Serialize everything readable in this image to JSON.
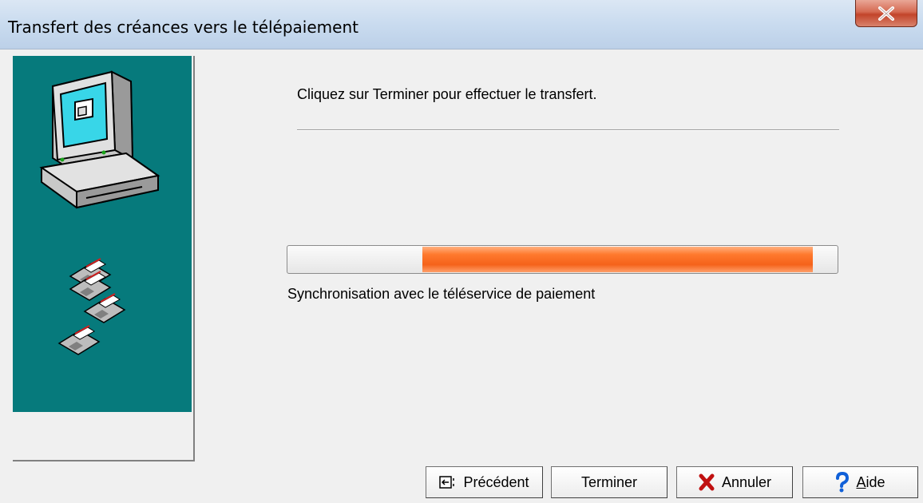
{
  "window": {
    "title": "Transfert des créances vers le télépaiement",
    "close_symbol": "x"
  },
  "wizard": {
    "instruction": "Cliquez sur Terminer pour effectuer le transfert.",
    "progress": {
      "start_fraction": 0.245,
      "end_fraction": 0.955,
      "status_text": "Synchronisation avec le téléservice de paiement"
    },
    "illustration_icons": [
      "computer-icon",
      "floppy-disks-icon"
    ]
  },
  "buttons": {
    "previous": {
      "label": "Précédent",
      "icon": "back-arrow-icon"
    },
    "finish": {
      "label": "Terminer"
    },
    "cancel": {
      "label": "Annuler",
      "icon": "red-x-icon"
    },
    "help": {
      "label_underlined": "A",
      "label_rest": "ide",
      "icon": "question-mark-icon"
    }
  },
  "colors": {
    "panel_teal": "#067a7c",
    "progress_orange": "#f5621a"
  }
}
